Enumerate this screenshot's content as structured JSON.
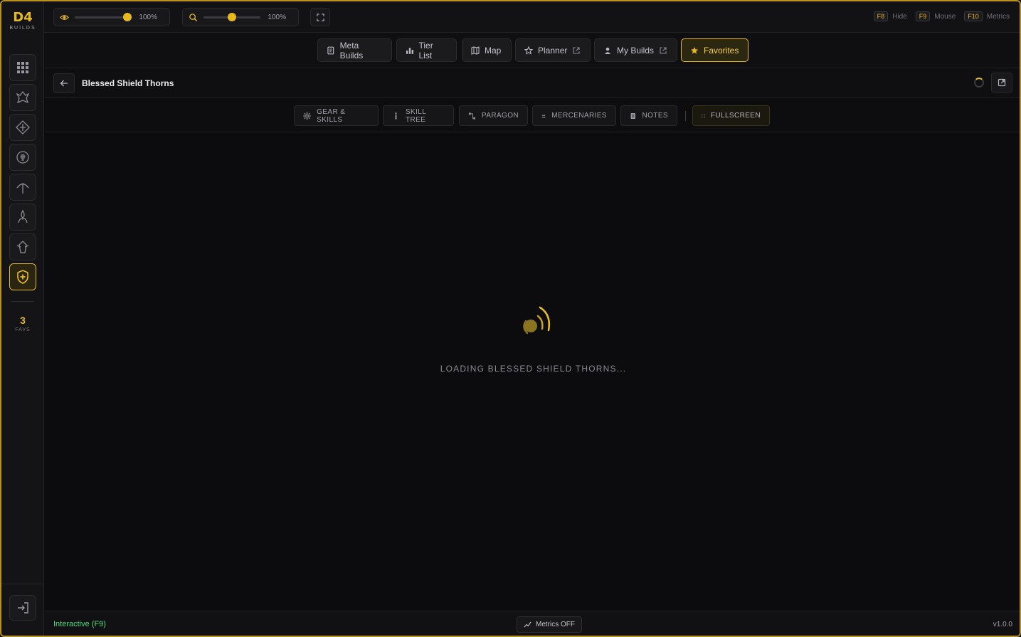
{
  "app": {
    "logo_main": "D4",
    "logo_sub": "BUILDS"
  },
  "sidebar": {
    "favs_count": "3",
    "favs_label": "FAVS",
    "items": [
      {
        "icon": "grid-icon"
      },
      {
        "icon": "barbarian-icon"
      },
      {
        "icon": "druid-icon"
      },
      {
        "icon": "necromancer-icon"
      },
      {
        "icon": "rogue-icon"
      },
      {
        "icon": "sorcerer-icon"
      },
      {
        "icon": "spiritborn-icon"
      },
      {
        "icon": "paladin-shield-icon"
      }
    ]
  },
  "topbar": {
    "opacity_value": "100%",
    "zoom_value": "100%",
    "hotkeys": [
      {
        "key": "F8",
        "label": "Hide"
      },
      {
        "key": "F9",
        "label": "Mouse"
      },
      {
        "key": "F10",
        "label": "Metrics"
      }
    ]
  },
  "nav": {
    "meta_builds": "Meta Builds",
    "tier_list": "Tier List",
    "map": "Map",
    "planner": "Planner",
    "my_builds": "My Builds",
    "favorites": "Favorites"
  },
  "build": {
    "title": "Blessed Shield Thorns"
  },
  "tabs": {
    "gear": "GEAR & SKILLS",
    "skill_tree": "SKILL TREE",
    "paragon": "PARAGON",
    "mercenaries": "MERCENARIES",
    "notes": "NOTES",
    "fullscreen": "FULLSCREEN"
  },
  "loading": {
    "text": "LOADING BLESSED SHIELD THORNS..."
  },
  "status": {
    "mode": "Interactive (F9)",
    "metrics": "Metrics OFF",
    "version": "v1.0.0"
  },
  "colors": {
    "accent": "#e6b91e",
    "status_green": "#4ade80"
  }
}
